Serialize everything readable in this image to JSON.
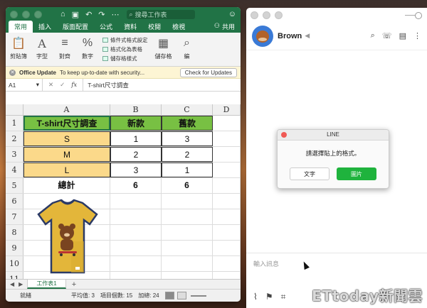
{
  "excel": {
    "search_placeholder": "搜尋工作表",
    "tabs": [
      "常用",
      "插入",
      "版面配置",
      "公式",
      "資料",
      "校閱",
      "檢視"
    ],
    "share_label": "共用",
    "ribbon": {
      "paste": "剪貼簿",
      "font": "字型",
      "align": "對齊",
      "number": "數字",
      "cond_format": "條件式格式設定",
      "format_table": "格式化為表格",
      "cell_style": "儲存格樣式",
      "cells": "儲存格",
      "edit": "編"
    },
    "message_bar": {
      "title": "Office Update",
      "text": "To keep up-to-date with security...",
      "button": "Check for Updates"
    },
    "formula_bar": {
      "name_box": "A1",
      "fx": "fx",
      "value": "T-shirt尺寸調查"
    },
    "columns": [
      "A",
      "B",
      "C",
      "D"
    ],
    "rows": [
      "1",
      "2",
      "3",
      "4",
      "5",
      "6",
      "7",
      "8",
      "9",
      "10",
      "11"
    ],
    "table": {
      "header": [
        "T-shirt尺寸調查",
        "新款",
        "舊款"
      ],
      "body": [
        [
          "S",
          "1",
          "3"
        ],
        [
          "M",
          "2",
          "2"
        ],
        [
          "L",
          "3",
          "1"
        ],
        [
          "總計",
          "6",
          "6"
        ]
      ]
    },
    "sheet_tab": "工作表1",
    "status": {
      "ready": "就緒",
      "average": "平均值: 3",
      "count": "項目個數: 15",
      "sum": "加總: 24"
    }
  },
  "line": {
    "contact_name": "Brown",
    "input_placeholder": "輸入訊息",
    "dialog": {
      "title": "LINE",
      "message": "請選擇貼上的格式。",
      "text_button": "文字",
      "image_button": "圖片"
    }
  },
  "watermark": "ETtoday新聞雲",
  "colors": {
    "excel_green": "#217346",
    "header_fill": "#78c043",
    "row_fill": "#fbd98a",
    "line_green": "#1fb33d"
  }
}
